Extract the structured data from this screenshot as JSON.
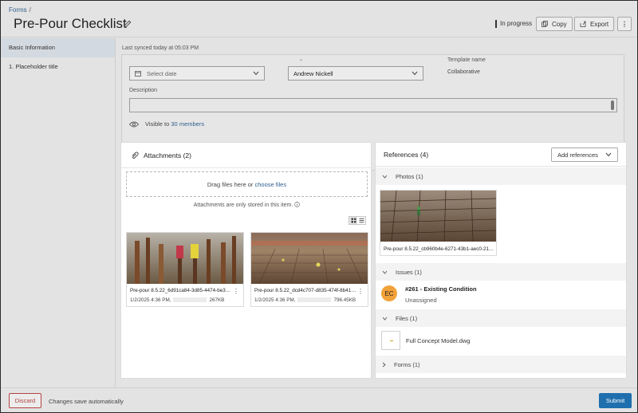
{
  "header": {
    "breadcrumb": "Forms",
    "breadcrumb_sep": "/",
    "title": "Pre-Pour Checklist",
    "status": "In progress",
    "copy_label": "Copy",
    "export_label": "Export",
    "more_label": "⋮"
  },
  "sidebar": {
    "items": [
      {
        "label": "Basic Information"
      },
      {
        "label": "1. Placeholder title"
      }
    ]
  },
  "main": {
    "sync_text": "Last synced today at 05:03 PM",
    "date_placeholder": "Select date",
    "assignee_value": "Andrew Nickell",
    "assignee_caret": "⌄",
    "template_label": "Template name",
    "template_value": "Collaborative",
    "description_label": "Description",
    "visible_text": "Visible to",
    "visible_link": "30 members"
  },
  "attachments": {
    "title": "Attachments (2)",
    "drop_text": "Drag files here or",
    "drop_link": "choose files",
    "note": "Attachments are only stored in this item.",
    "files": [
      {
        "name": "Pre-pour 8.5.22_6d91ca84-3d85-4474-be3…",
        "date": "1/2/2025 4:36 PM,",
        "size": "267KB"
      },
      {
        "name": "Pre-pour 8.5.22_dcd4c707-d835-474f-8b41…",
        "date": "1/2/2025 4:36 PM,",
        "size": "796.45KB"
      }
    ]
  },
  "references": {
    "title": "References (4)",
    "add_label": "Add references",
    "sections": {
      "photos": "Photos (1)",
      "issues": "Issues (1)",
      "files": "Files (1)",
      "forms": "Forms (1)"
    },
    "photo_name": "Pre-pour 8.5.22_cb960b4e-6271-43b1-aec0-21…",
    "issue": {
      "initials": "EC",
      "title": "#261 - Existing Condition",
      "sub": "Unassigned"
    },
    "file_name": "Full Concept Model.dwg"
  },
  "footer": {
    "discard": "Discard",
    "autosave": "Changes save automatically",
    "submit": "Submit"
  }
}
